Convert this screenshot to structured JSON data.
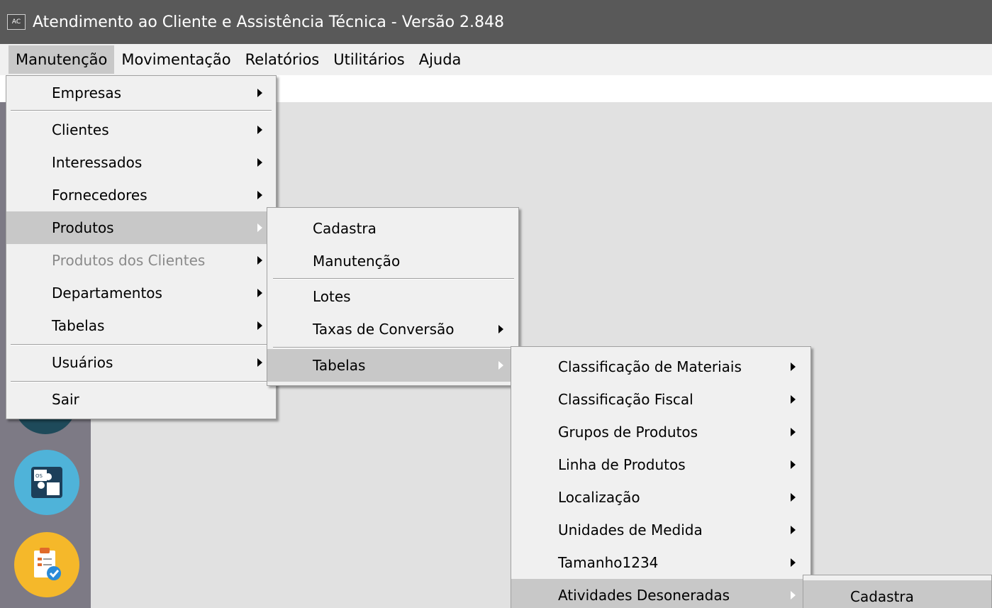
{
  "app": {
    "logo_text": "AC",
    "title": "Atendimento ao Cliente e Assistência Técnica - Versão 2.848"
  },
  "menubar": {
    "items": [
      "Manutenção",
      "Movimentação",
      "Relatórios",
      "Utilitários",
      "Ajuda"
    ]
  },
  "menu_manutencao": {
    "items": [
      {
        "label": "Empresas"
      },
      {
        "label": "Clientes"
      },
      {
        "label": "Interessados"
      },
      {
        "label": "Fornecedores"
      },
      {
        "label": "Produtos"
      },
      {
        "label": "Produtos dos Clientes"
      },
      {
        "label": "Departamentos"
      },
      {
        "label": "Tabelas"
      },
      {
        "label": "Usuários"
      },
      {
        "label": "Sair"
      }
    ]
  },
  "menu_produtos": {
    "items": [
      {
        "label": "Cadastra"
      },
      {
        "label": "Manutenção"
      },
      {
        "label": "Lotes"
      },
      {
        "label": "Taxas de Conversão"
      },
      {
        "label": "Tabelas"
      }
    ]
  },
  "menu_tabelas": {
    "items": [
      {
        "label": "Classificação de Materiais"
      },
      {
        "label": "Classificação Fiscal"
      },
      {
        "label": "Grupos de Produtos"
      },
      {
        "label": "Linha de Produtos"
      },
      {
        "label": "Localização"
      },
      {
        "label": "Unidades de Medida"
      },
      {
        "label": "Tamanho1234"
      },
      {
        "label": "Atividades Desoneradas"
      }
    ]
  },
  "menu_atividades": {
    "items": [
      {
        "label": "Cadastra"
      }
    ]
  },
  "colors": {
    "titlebar": "#595959",
    "menu_bg": "#f0f0f0",
    "highlight": "#c8c8c8",
    "dock": "#7d7a85"
  }
}
